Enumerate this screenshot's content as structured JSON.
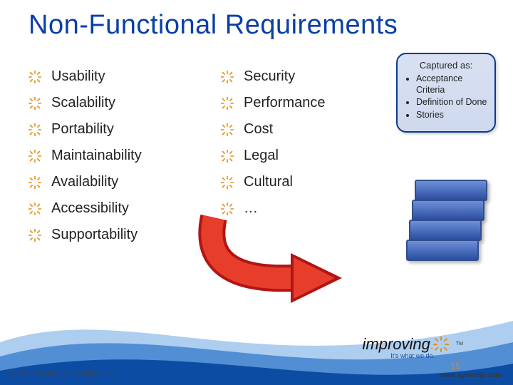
{
  "title": "Non-Functional Requirements",
  "left_items": [
    "Usability",
    "Scalability",
    "Portability",
    "Maintainability",
    "Availability",
    "Accessibility",
    "Supportability"
  ],
  "right_items": [
    "Security",
    "Performance",
    "Cost",
    "Legal",
    "Cultural",
    "…"
  ],
  "callout": {
    "caption": "Captured as:",
    "items": [
      "Acceptance Criteria",
      "Definition of Done",
      "Stories"
    ]
  },
  "footer": {
    "copyright": "© 2012 Improving Enterprises, Inc.",
    "brand_word": "improving",
    "brand_tag": "It's what we do.",
    "tm": "TM",
    "page": "15",
    "url": "www.synerzip.com"
  }
}
